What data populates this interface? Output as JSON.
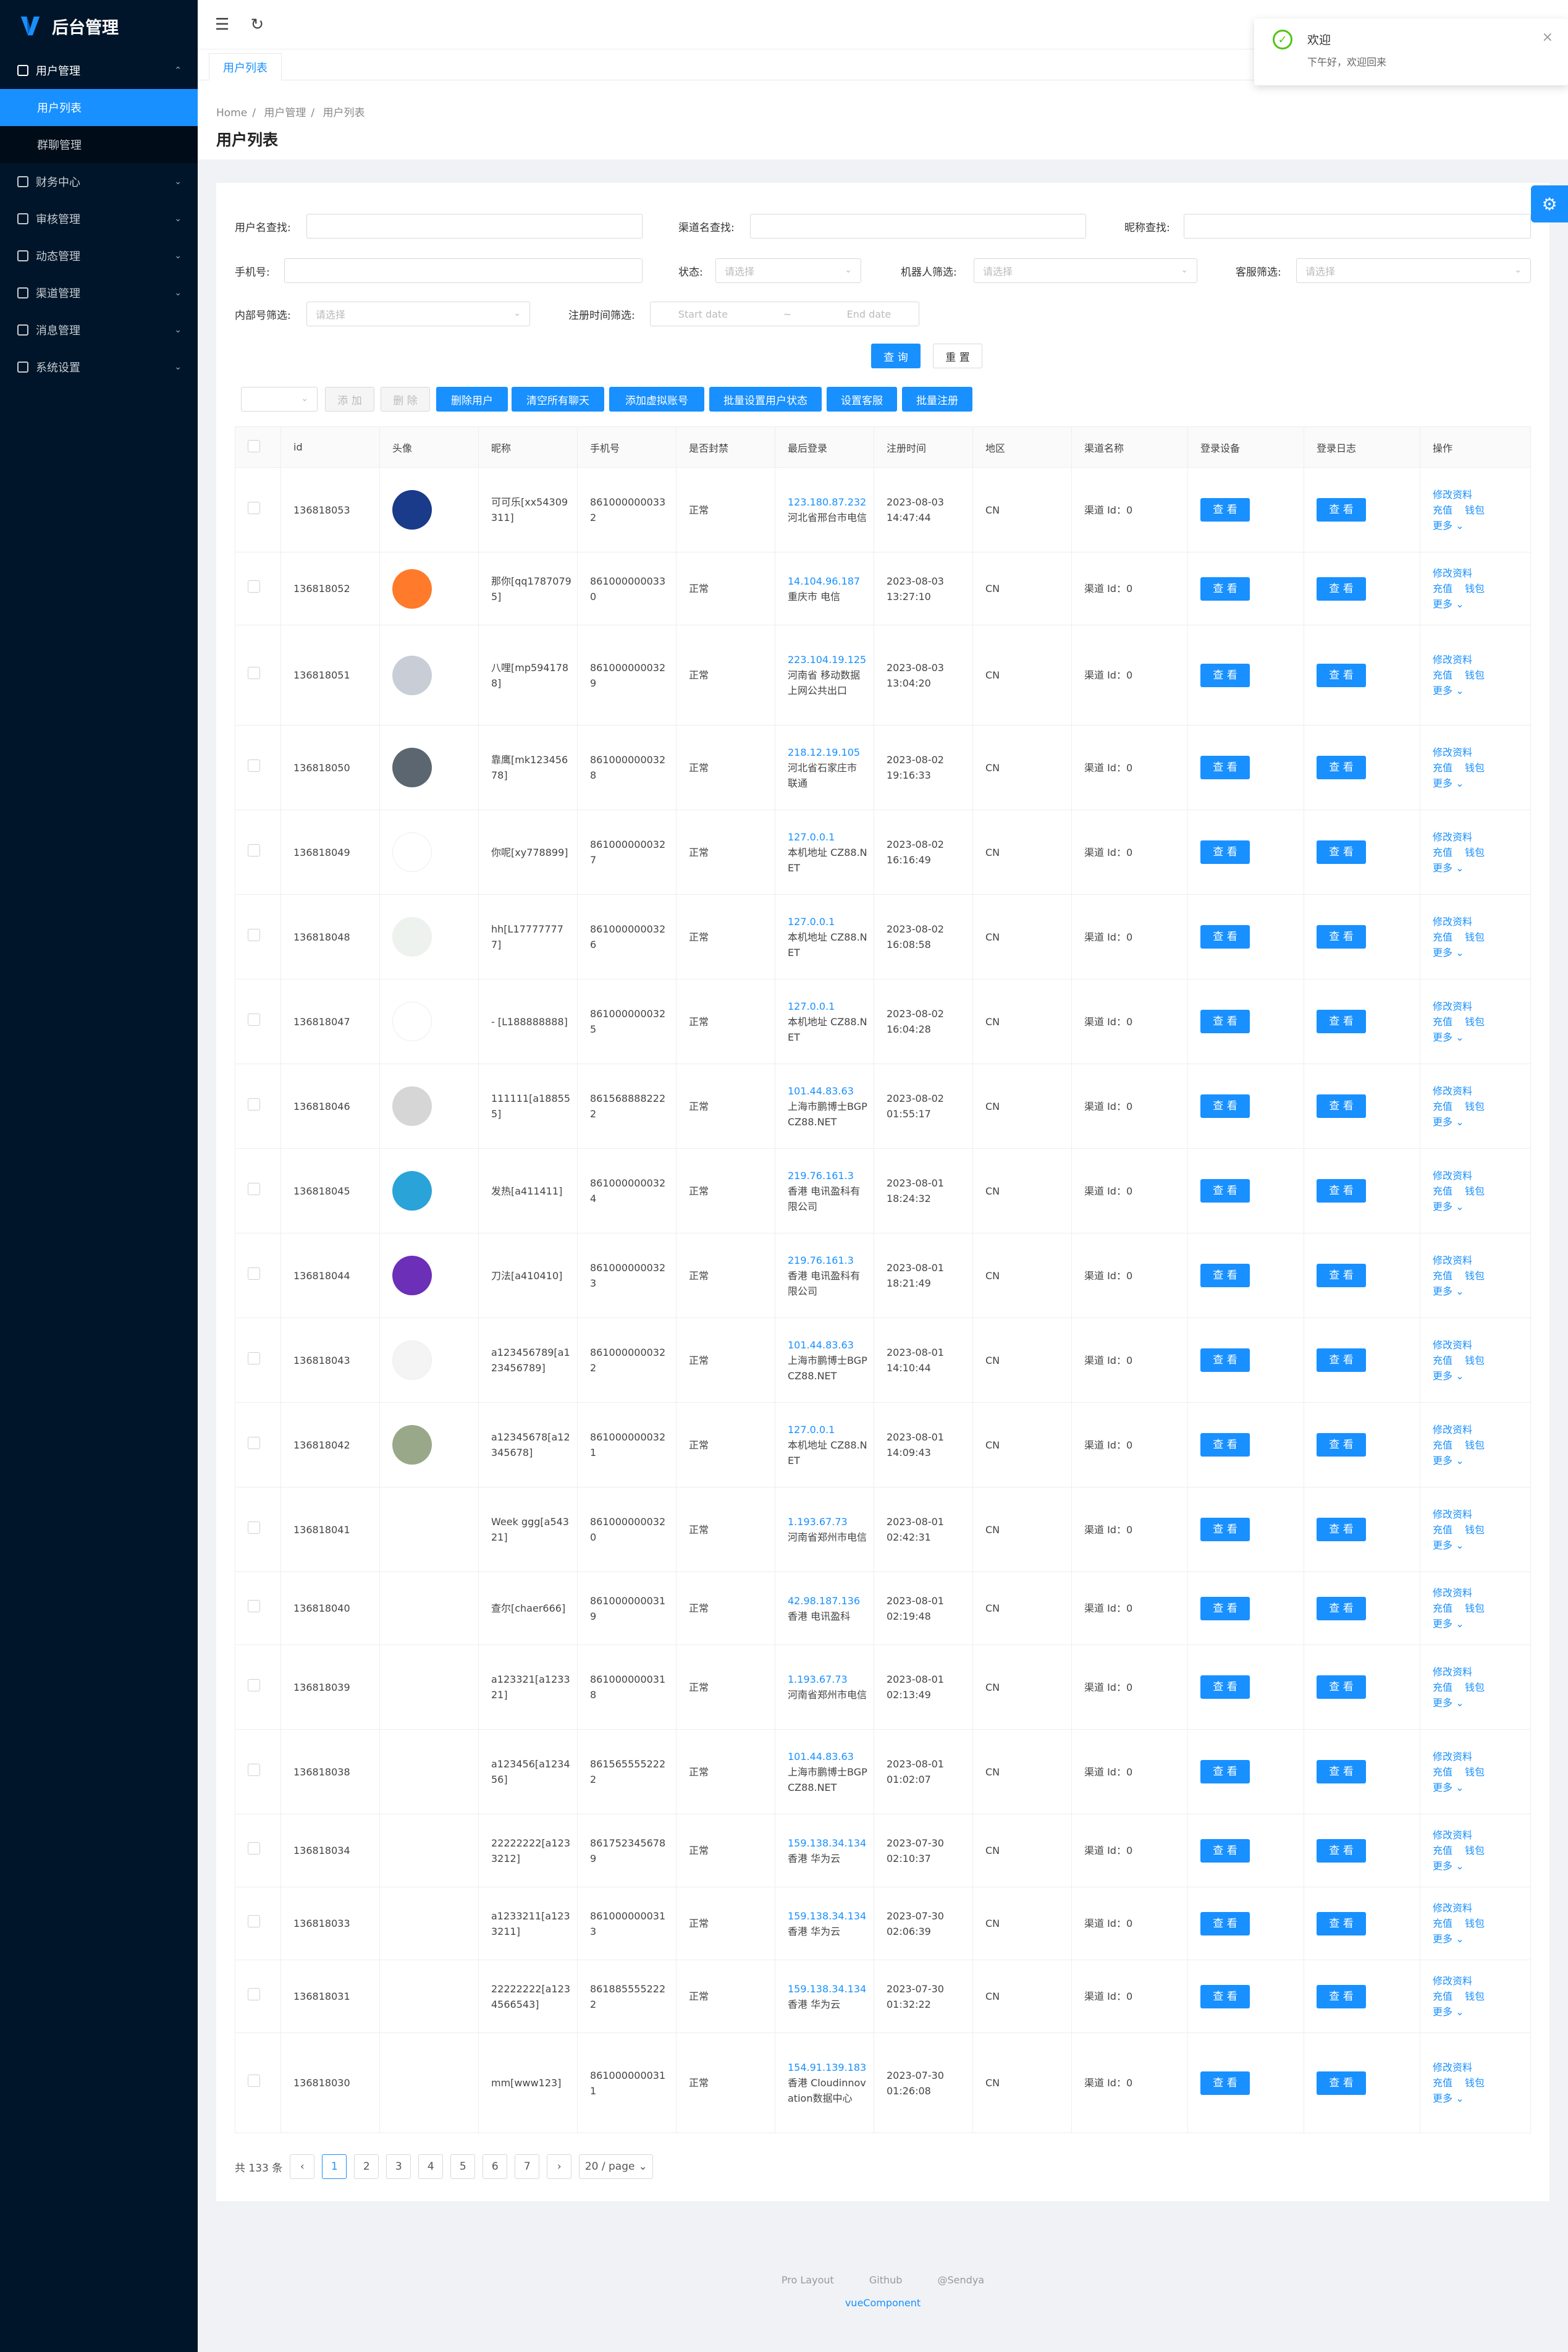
{
  "app": {
    "title": "后台管理"
  },
  "sidebar": {
    "groups": [
      {
        "label": "用户管理",
        "icon": "table-icon",
        "open": true,
        "items": [
          {
            "label": "用户列表",
            "active": true
          },
          {
            "label": "群聊管理"
          }
        ]
      },
      {
        "label": "财务中心",
        "icon": "finance-icon"
      },
      {
        "label": "审核管理",
        "icon": "audit-icon"
      },
      {
        "label": "动态管理",
        "icon": "feed-icon"
      },
      {
        "label": "渠道管理",
        "icon": "channel-icon"
      },
      {
        "label": "消息管理",
        "icon": "message-icon"
      },
      {
        "label": "系统设置",
        "icon": "settings-icon"
      }
    ]
  },
  "tabs": [
    {
      "label": "用户列表",
      "active": true
    }
  ],
  "breadcrumb": [
    "Home",
    "用户管理",
    "用户列表"
  ],
  "page_title": "用户列表",
  "filters": {
    "username_label": "用户名查找:",
    "channel_label": "渠道名查找:",
    "nickname_label": "昵称查找:",
    "phone_label": "手机号:",
    "status_label": "状态:",
    "robot_label": "机器人筛选:",
    "service_label": "客服筛选:",
    "internal_label": "内部号筛选:",
    "regtime_label": "注册时间筛选:",
    "select_placeholder": "请选择",
    "start_placeholder": "Start date",
    "end_placeholder": "End date",
    "range_sep": "~",
    "search_btn": "查 询",
    "reset_btn": "重 置"
  },
  "toolbar": {
    "add": "添 加",
    "delete": "删 除",
    "delete_user": "删除用户",
    "clear_chat": "清空所有聊天",
    "add_virtual": "添加虚拟账号",
    "batch_status": "批量设置用户状态",
    "set_service": "设置客服",
    "batch_register": "批量注册"
  },
  "table": {
    "headers": [
      "id",
      "头像",
      "昵称",
      "手机号",
      "是否封禁",
      "最后登录",
      "注册时间",
      "地区",
      "渠道名称",
      "登录设备",
      "登录日志",
      "操作"
    ],
    "view_label": "查 看",
    "ops": {
      "edit": "修改资料",
      "recharge": "充值",
      "wallet": "钱包",
      "more": "更多"
    },
    "rows": [
      {
        "id": "136818053",
        "nick": "可可乐[xx54309311]",
        "phone": "8610000000332",
        "status": "正常",
        "ip": "123.180.87.232",
        "loc": "河北省邢台市电信",
        "reg": "2023-08-03 14:47:44",
        "region": "CN",
        "channel": "渠道 Id：0",
        "avatar": "#1a3a8a"
      },
      {
        "id": "136818052",
        "nick": "那你[qq17870795]",
        "phone": "8610000000330",
        "status": "正常",
        "ip": "14.104.96.187",
        "loc": "重庆市 电信",
        "reg": "2023-08-03 13:27:10",
        "region": "CN",
        "channel": "渠道 Id：0",
        "avatar": "#ff7a2a"
      },
      {
        "id": "136818051",
        "nick": "八哩[mp5941788]",
        "phone": "8610000000329",
        "status": "正常",
        "ip": "223.104.19.125",
        "loc": "河南省 移动数据上网公共出口",
        "reg": "2023-08-03 13:04:20",
        "region": "CN",
        "channel": "渠道 Id：0",
        "avatar": "#c9ced6"
      },
      {
        "id": "136818050",
        "nick": "靠鹰[mk12345678]",
        "phone": "8610000000328",
        "status": "正常",
        "ip": "218.12.19.105",
        "loc": "河北省石家庄市 联通",
        "reg": "2023-08-02 19:16:33",
        "region": "CN",
        "channel": "渠道 Id：0",
        "avatar": "#5c6670"
      },
      {
        "id": "136818049",
        "nick": "你呢[xy778899]",
        "phone": "8610000000327",
        "status": "正常",
        "ip": "127.0.0.1",
        "loc": "本机地址 CZ88.NET",
        "reg": "2023-08-02 16:16:49",
        "region": "CN",
        "channel": "渠道 Id：0",
        "avatar": "#ffffff"
      },
      {
        "id": "136818048",
        "nick": "hh[L177777777]",
        "phone": "8610000000326",
        "status": "正常",
        "ip": "127.0.0.1",
        "loc": "本机地址 CZ88.NET",
        "reg": "2023-08-02 16:08:58",
        "region": "CN",
        "channel": "渠道 Id：0",
        "avatar": "#eef2ef"
      },
      {
        "id": "136818047",
        "nick": "- [L188888888]",
        "phone": "8610000000325",
        "status": "正常",
        "ip": "127.0.0.1",
        "loc": "本机地址 CZ88.NET",
        "reg": "2023-08-02 16:04:28",
        "region": "CN",
        "channel": "渠道 Id：0",
        "avatar": "#ffffff"
      },
      {
        "id": "136818046",
        "nick": "111111[a188555]",
        "phone": "8615688882222",
        "status": "正常",
        "ip": "101.44.83.63",
        "loc": "上海市鹏博士BGP CZ88.NET",
        "reg": "2023-08-02 01:55:17",
        "region": "CN",
        "channel": "渠道 Id：0",
        "avatar": "#d6d6d6"
      },
      {
        "id": "136818045",
        "nick": "发热[a411411]",
        "phone": "8610000000324",
        "status": "正常",
        "ip": "219.76.161.3",
        "loc": "香港 电讯盈科有限公司",
        "reg": "2023-08-01 18:24:32",
        "region": "CN",
        "channel": "渠道 Id：0",
        "avatar": "#2aa3d8"
      },
      {
        "id": "136818044",
        "nick": "刀法[a410410]",
        "phone": "8610000000323",
        "status": "正常",
        "ip": "219.76.161.3",
        "loc": "香港 电讯盈科有限公司",
        "reg": "2023-08-01 18:21:49",
        "region": "CN",
        "channel": "渠道 Id：0",
        "avatar": "#6b2fb8"
      },
      {
        "id": "136818043",
        "nick": "a123456789[a123456789]",
        "phone": "8610000000322",
        "status": "正常",
        "ip": "101.44.83.63",
        "loc": "上海市鹏博士BGP CZ88.NET",
        "reg": "2023-08-01 14:10:44",
        "region": "CN",
        "channel": "渠道 Id：0",
        "avatar": "#f4f4f4"
      },
      {
        "id": "136818042",
        "nick": "a12345678[a12345678]",
        "phone": "8610000000321",
        "status": "正常",
        "ip": "127.0.0.1",
        "loc": "本机地址 CZ88.NET",
        "reg": "2023-08-01 14:09:43",
        "region": "CN",
        "channel": "渠道 Id：0",
        "avatar": "#9aa88a"
      },
      {
        "id": "136818041",
        "nick": "Week ggg[a54321]",
        "phone": "8610000000320",
        "status": "正常",
        "ip": "1.193.67.73",
        "loc": "河南省郑州市电信",
        "reg": "2023-08-01 02:42:31",
        "region": "CN",
        "channel": "渠道 Id：0",
        "avatar": ""
      },
      {
        "id": "136818040",
        "nick": "查尔[chaer666]",
        "phone": "8610000000319",
        "status": "正常",
        "ip": "42.98.187.136",
        "loc": "香港 电讯盈科",
        "reg": "2023-08-01 02:19:48",
        "region": "CN",
        "channel": "渠道 Id：0",
        "avatar": ""
      },
      {
        "id": "136818039",
        "nick": "a123321[a123321]",
        "phone": "8610000000318",
        "status": "正常",
        "ip": "1.193.67.73",
        "loc": "河南省郑州市电信",
        "reg": "2023-08-01 02:13:49",
        "region": "CN",
        "channel": "渠道 Id：0",
        "avatar": ""
      },
      {
        "id": "136818038",
        "nick": "a123456[a123456]",
        "phone": "8615655552222",
        "status": "正常",
        "ip": "101.44.83.63",
        "loc": "上海市鹏博士BGP CZ88.NET",
        "reg": "2023-08-01 01:02:07",
        "region": "CN",
        "channel": "渠道 Id：0",
        "avatar": ""
      },
      {
        "id": "136818034",
        "nick": "22222222[a1233212]",
        "phone": "8617523456789",
        "status": "正常",
        "ip": "159.138.34.134",
        "loc": "香港 华为云",
        "reg": "2023-07-30 02:10:37",
        "region": "CN",
        "channel": "渠道 Id：0",
        "avatar": ""
      },
      {
        "id": "136818033",
        "nick": "a1233211[a1233211]",
        "phone": "8610000000313",
        "status": "正常",
        "ip": "159.138.34.134",
        "loc": "香港 华为云",
        "reg": "2023-07-30 02:06:39",
        "region": "CN",
        "channel": "渠道 Id：0",
        "avatar": ""
      },
      {
        "id": "136818031",
        "nick": "22222222[a1234566543]",
        "phone": "8618855552222",
        "status": "正常",
        "ip": "159.138.34.134",
        "loc": "香港 华为云",
        "reg": "2023-07-30 01:32:22",
        "region": "CN",
        "channel": "渠道 Id：0",
        "avatar": ""
      },
      {
        "id": "136818030",
        "nick": "mm[www123]",
        "phone": "8610000000311",
        "status": "正常",
        "ip": "154.91.139.183",
        "loc": "香港 Cloudinnovation数据中心",
        "reg": "2023-07-30 01:26:08",
        "region": "CN",
        "channel": "渠道 Id：0",
        "avatar": ""
      }
    ]
  },
  "pagination": {
    "total": "共 133 条",
    "pages": [
      "1",
      "2",
      "3",
      "4",
      "5",
      "6",
      "7"
    ],
    "current": "1",
    "page_size": "20 / page"
  },
  "footer": {
    "links": [
      "Pro Layout",
      "Github",
      "@Sendya"
    ],
    "sub": "vueComponent"
  },
  "toast": {
    "title": "欢迎",
    "message": "下午好，欢迎回来"
  }
}
